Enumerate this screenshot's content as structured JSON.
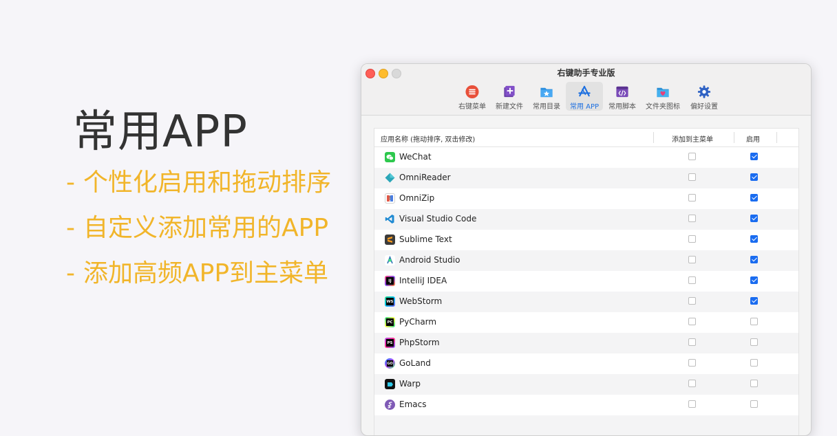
{
  "promo": {
    "title": "常用APP",
    "features": [
      "个性化启用和拖动排序",
      "自定义添加常用的APP",
      "添加高频APP到主菜单"
    ],
    "dash": "-",
    "title_color": "#333333",
    "feature_color": "#f1b52a"
  },
  "window": {
    "title": "右键助手专业版",
    "toolbar": [
      {
        "label": "右键菜单",
        "icon": "menu-list-icon",
        "active": false
      },
      {
        "label": "新建文件",
        "icon": "new-file-icon",
        "active": false
      },
      {
        "label": "常用目录",
        "icon": "folder-star-icon",
        "active": false
      },
      {
        "label": "常用 APP",
        "icon": "app-store-icon",
        "active": true
      },
      {
        "label": "常用脚本",
        "icon": "script-icon",
        "active": false
      },
      {
        "label": "文件夹图标",
        "icon": "folder-heart-icon",
        "active": false
      },
      {
        "label": "偏好设置",
        "icon": "gear-icon",
        "active": false
      }
    ],
    "accent_color": "#1a6cf0"
  },
  "table": {
    "headers": {
      "name": "应用名称 (拖动排序, 双击修改)",
      "main_menu": "添加到主菜单",
      "enabled": "启用"
    },
    "rows": [
      {
        "name": "WeChat",
        "icon": "wechat-icon",
        "main_menu": false,
        "enabled": true
      },
      {
        "name": "OmniReader",
        "icon": "omnireader-icon",
        "main_menu": false,
        "enabled": true
      },
      {
        "name": "OmniZip",
        "icon": "omnizip-icon",
        "main_menu": false,
        "enabled": true
      },
      {
        "name": "Visual Studio Code",
        "icon": "vscode-icon",
        "main_menu": false,
        "enabled": true
      },
      {
        "name": "Sublime Text",
        "icon": "sublime-icon",
        "main_menu": false,
        "enabled": true
      },
      {
        "name": "Android Studio",
        "icon": "android-studio-icon",
        "main_menu": false,
        "enabled": true
      },
      {
        "name": "IntelliJ IDEA",
        "icon": "intellij-icon",
        "main_menu": false,
        "enabled": true
      },
      {
        "name": "WebStorm",
        "icon": "webstorm-icon",
        "main_menu": false,
        "enabled": true
      },
      {
        "name": "PyCharm",
        "icon": "pycharm-icon",
        "main_menu": false,
        "enabled": false
      },
      {
        "name": "PhpStorm",
        "icon": "phpstorm-icon",
        "main_menu": false,
        "enabled": false
      },
      {
        "name": "GoLand",
        "icon": "goland-icon",
        "main_menu": false,
        "enabled": false
      },
      {
        "name": "Warp",
        "icon": "warp-icon",
        "main_menu": false,
        "enabled": false
      },
      {
        "name": "Emacs",
        "icon": "emacs-icon",
        "main_menu": false,
        "enabled": false
      }
    ]
  }
}
